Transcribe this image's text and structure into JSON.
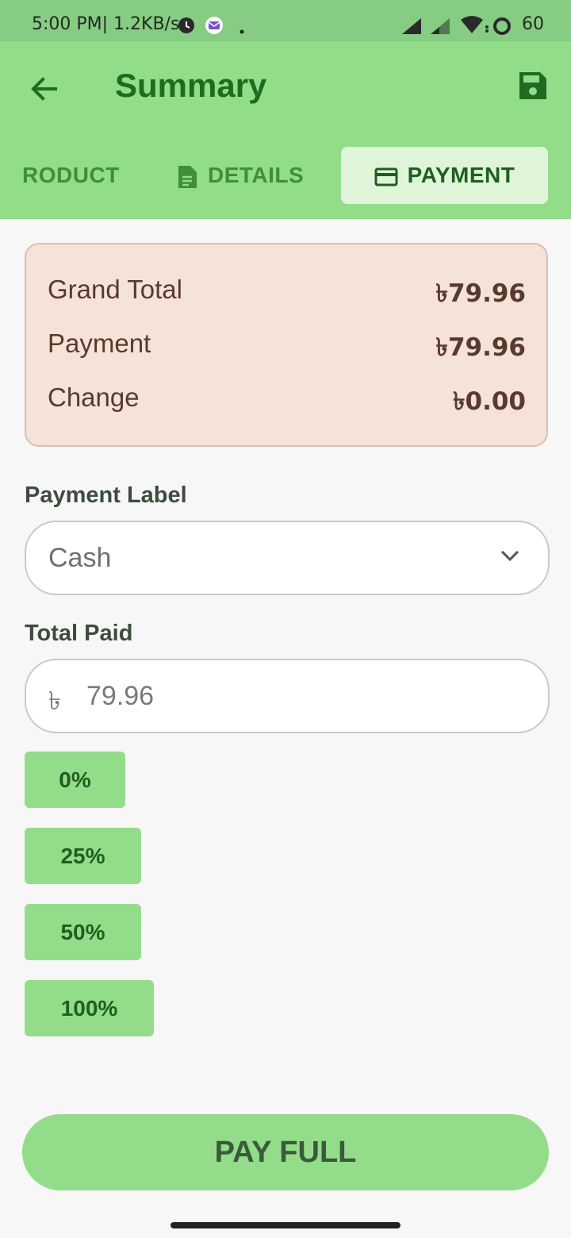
{
  "status_bar": {
    "time_speed": "5:00 PM| 1.2KB/s",
    "battery": "60"
  },
  "app_bar": {
    "title": "Summary",
    "icons": {
      "back": "arrow-back-icon",
      "save": "save-icon"
    }
  },
  "tabs": [
    {
      "label": "RODUCT",
      "icon": "",
      "active": false
    },
    {
      "label": "DETAILS",
      "icon": "document-icon",
      "active": false
    },
    {
      "label": "PAYMENT",
      "icon": "credit-card-icon",
      "active": true
    }
  ],
  "summary": {
    "rows": [
      {
        "label": "Grand Total",
        "value": "৳79.96"
      },
      {
        "label": "Payment",
        "value": "৳79.96"
      },
      {
        "label": "Change",
        "value": "৳0.00"
      }
    ]
  },
  "payment_label": {
    "label": "Payment Label",
    "selected": "Cash"
  },
  "total_paid": {
    "label": "Total Paid",
    "currency": "৳",
    "value": "79.96"
  },
  "quick_percent": [
    "0%",
    "25%",
    "50%",
    "100%"
  ],
  "pay_full_label": "PAY FULL",
  "colors": {
    "status_bar": "#86cc82",
    "app_bar": "#93dc8a",
    "title": "#1f6b1f",
    "summary_bg": "#f5e2d8",
    "summary_text": "#5a3a2e",
    "button": "#93dc8a"
  }
}
